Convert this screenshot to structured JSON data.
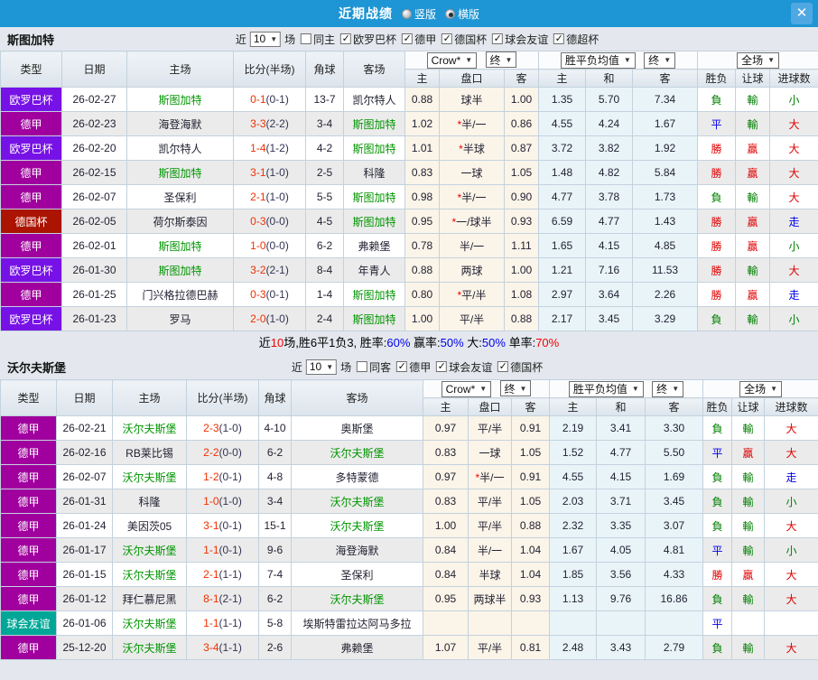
{
  "titlebar": {
    "title": "近期战绩",
    "vertical_label": "竖版",
    "horizontal_label": "横版",
    "selected_layout": "横版",
    "close_glyph": "✕"
  },
  "table_columns": {
    "type": "类型",
    "date": "日期",
    "home": "主场",
    "score": "比分(半场)",
    "corner": "角球",
    "away": "客场",
    "crow": "Crow*",
    "final1": "终",
    "avg": "胜平负均值",
    "final2": "终",
    "scope": "全场",
    "sub_home": "主",
    "sub_handicap": "盘口",
    "sub_away": "客",
    "sub_avg_home": "主",
    "sub_avg_draw": "和",
    "sub_avg_away": "客",
    "sub_result": "胜负",
    "sub_handicap_result": "让球",
    "sub_goals": "进球数",
    "dropdown_arrow": "▼"
  },
  "colors": {
    "accent_blue": "#1e95d4",
    "focus_team_green": "#009500",
    "score_red": "#f23000",
    "type_badges": {
      "欧罗巴杯": "#7712e6",
      "德甲": "#a0009e",
      "德国杯": "#aa1400",
      "球会友谊": "#00a796"
    },
    "result_text": {
      "勝": "#e00000",
      "負": "#008000",
      "平": "#0000ee",
      "贏": "#e00000",
      "輸": "#008000",
      "走": "#0000ee",
      "大": "#e00000",
      "小": "#008000"
    }
  },
  "sections": [
    {
      "team": "斯图加特",
      "filter": {
        "near": "近",
        "games": "10",
        "games_unit": "场",
        "same": {
          "label": "同主",
          "checked": false
        },
        "competitions": [
          {
            "label": "欧罗巴杯",
            "checked": true
          },
          {
            "label": "德甲",
            "checked": true
          },
          {
            "label": "德国杯",
            "checked": true
          },
          {
            "label": "球会友谊",
            "checked": true
          },
          {
            "label": "德超杯",
            "checked": true
          }
        ]
      },
      "rows": [
        {
          "league": "欧罗巴杯",
          "date": "26-02-27",
          "home": "斯图加特",
          "home_is_focus": true,
          "score": "0-1",
          "half": "0-1",
          "corners": "13-7",
          "away": "凯尔特人",
          "away_is_focus": false,
          "crow_home": "0.88",
          "handicap_star": false,
          "handicap": "球半",
          "crow_away": "1.00",
          "avg_home": "1.35",
          "avg_draw": "5.70",
          "avg_away": "7.34",
          "result": "負",
          "handicap_result": "輸",
          "goals": "小"
        },
        {
          "league": "德甲",
          "date": "26-02-23",
          "home": "海登海默",
          "home_is_focus": false,
          "score": "3-3",
          "half": "2-2",
          "corners": "3-4",
          "away": "斯图加特",
          "away_is_focus": true,
          "crow_home": "1.02",
          "handicap_star": true,
          "handicap": "半/一",
          "crow_away": "0.86",
          "avg_home": "4.55",
          "avg_draw": "4.24",
          "avg_away": "1.67",
          "result": "平",
          "handicap_result": "輸",
          "goals": "大"
        },
        {
          "league": "欧罗巴杯",
          "date": "26-02-20",
          "home": "凯尔特人",
          "home_is_focus": false,
          "score": "1-4",
          "half": "1-2",
          "corners": "4-2",
          "away": "斯图加特",
          "away_is_focus": true,
          "crow_home": "1.01",
          "handicap_star": true,
          "handicap": "半球",
          "crow_away": "0.87",
          "avg_home": "3.72",
          "avg_draw": "3.82",
          "avg_away": "1.92",
          "result": "勝",
          "handicap_result": "贏",
          "goals": "大"
        },
        {
          "league": "德甲",
          "date": "26-02-15",
          "home": "斯图加特",
          "home_is_focus": true,
          "score": "3-1",
          "half": "1-0",
          "corners": "2-5",
          "away": "科隆",
          "away_is_focus": false,
          "crow_home": "0.83",
          "handicap_star": false,
          "handicap": "一球",
          "crow_away": "1.05",
          "avg_home": "1.48",
          "avg_draw": "4.82",
          "avg_away": "5.84",
          "result": "勝",
          "handicap_result": "贏",
          "goals": "大"
        },
        {
          "league": "德甲",
          "date": "26-02-07",
          "home": "圣保利",
          "home_is_focus": false,
          "score": "2-1",
          "half": "1-0",
          "corners": "5-5",
          "away": "斯图加特",
          "away_is_focus": true,
          "crow_home": "0.98",
          "handicap_star": true,
          "handicap": "半/一",
          "crow_away": "0.90",
          "avg_home": "4.77",
          "avg_draw": "3.78",
          "avg_away": "1.73",
          "result": "負",
          "handicap_result": "輸",
          "goals": "大"
        },
        {
          "league": "德国杯",
          "date": "26-02-05",
          "home": "荷尔斯泰因",
          "home_is_focus": false,
          "score": "0-3",
          "half": "0-0",
          "corners": "4-5",
          "away": "斯图加特",
          "away_is_focus": true,
          "crow_home": "0.95",
          "handicap_star": true,
          "handicap": "一/球半",
          "crow_away": "0.93",
          "avg_home": "6.59",
          "avg_draw": "4.77",
          "avg_away": "1.43",
          "result": "勝",
          "handicap_result": "贏",
          "goals": "走"
        },
        {
          "league": "德甲",
          "date": "26-02-01",
          "home": "斯图加特",
          "home_is_focus": true,
          "score": "1-0",
          "half": "0-0",
          "corners": "6-2",
          "away": "弗赖堡",
          "away_is_focus": false,
          "crow_home": "0.78",
          "handicap_star": false,
          "handicap": "半/一",
          "crow_away": "1.11",
          "avg_home": "1.65",
          "avg_draw": "4.15",
          "avg_away": "4.85",
          "result": "勝",
          "handicap_result": "贏",
          "goals": "小"
        },
        {
          "league": "欧罗巴杯",
          "date": "26-01-30",
          "home": "斯图加特",
          "home_is_focus": true,
          "score": "3-2",
          "half": "2-1",
          "corners": "8-4",
          "away": "年青人",
          "away_is_focus": false,
          "crow_home": "0.88",
          "handicap_star": false,
          "handicap": "两球",
          "crow_away": "1.00",
          "avg_home": "1.21",
          "avg_draw": "7.16",
          "avg_away": "11.53",
          "result": "勝",
          "handicap_result": "輸",
          "goals": "大"
        },
        {
          "league": "德甲",
          "date": "26-01-25",
          "home": "门兴格拉德巴赫",
          "home_is_focus": false,
          "score": "0-3",
          "half": "0-1",
          "corners": "1-4",
          "away": "斯图加特",
          "away_is_focus": true,
          "crow_home": "0.80",
          "handicap_star": true,
          "handicap": "平/半",
          "crow_away": "1.08",
          "avg_home": "2.97",
          "avg_draw": "3.64",
          "avg_away": "2.26",
          "result": "勝",
          "handicap_result": "贏",
          "goals": "走"
        },
        {
          "league": "欧罗巴杯",
          "date": "26-01-23",
          "home": "罗马",
          "home_is_focus": false,
          "score": "2-0",
          "half": "1-0",
          "corners": "2-4",
          "away": "斯图加特",
          "away_is_focus": true,
          "crow_home": "1.00",
          "handicap_star": false,
          "handicap": "平/半",
          "crow_away": "0.88",
          "avg_home": "2.17",
          "avg_draw": "3.45",
          "avg_away": "3.29",
          "result": "負",
          "handicap_result": "輸",
          "goals": "小"
        }
      ],
      "summary": [
        {
          "t": "近",
          "c": "#000000"
        },
        {
          "t": "10",
          "c": "#f00000"
        },
        {
          "t": "场,胜6平1负3, 胜率:",
          "c": "#000000"
        },
        {
          "t": "60%",
          "c": "#0000ee"
        },
        {
          "t": " 赢率:",
          "c": "#000000"
        },
        {
          "t": "50%",
          "c": "#0000ee"
        },
        {
          "t": " 大:",
          "c": "#000000"
        },
        {
          "t": "50%",
          "c": "#0000ee"
        },
        {
          "t": " 单率:",
          "c": "#000000"
        },
        {
          "t": "70%",
          "c": "#f00000"
        }
      ]
    },
    {
      "team": "沃尔夫斯堡",
      "filter": {
        "near": "近",
        "games": "10",
        "games_unit": "场",
        "same": {
          "label": "同客",
          "checked": false
        },
        "competitions": [
          {
            "label": "德甲",
            "checked": true
          },
          {
            "label": "球会友谊",
            "checked": true
          },
          {
            "label": "德国杯",
            "checked": true
          }
        ]
      },
      "rows": [
        {
          "league": "德甲",
          "date": "26-02-21",
          "home": "沃尔夫斯堡",
          "home_is_focus": true,
          "score": "2-3",
          "half": "1-0",
          "corners": "4-10",
          "away": "奥斯堡",
          "away_is_focus": false,
          "crow_home": "0.97",
          "handicap_star": false,
          "handicap": "平/半",
          "crow_away": "0.91",
          "avg_home": "2.19",
          "avg_draw": "3.41",
          "avg_away": "3.30",
          "result": "負",
          "handicap_result": "輸",
          "goals": "大"
        },
        {
          "league": "德甲",
          "date": "26-02-16",
          "home": "RB莱比锡",
          "home_is_focus": false,
          "score": "2-2",
          "half": "0-0",
          "corners": "6-2",
          "away": "沃尔夫斯堡",
          "away_is_focus": true,
          "crow_home": "0.83",
          "handicap_star": false,
          "handicap": "一球",
          "crow_away": "1.05",
          "avg_home": "1.52",
          "avg_draw": "4.77",
          "avg_away": "5.50",
          "result": "平",
          "handicap_result": "贏",
          "goals": "大"
        },
        {
          "league": "德甲",
          "date": "26-02-07",
          "home": "沃尔夫斯堡",
          "home_is_focus": true,
          "score": "1-2",
          "half": "0-1",
          "corners": "4-8",
          "away": "多特蒙德",
          "away_is_focus": false,
          "crow_home": "0.97",
          "handicap_star": true,
          "handicap": "半/一",
          "crow_away": "0.91",
          "avg_home": "4.55",
          "avg_draw": "4.15",
          "avg_away": "1.69",
          "result": "負",
          "handicap_result": "輸",
          "goals": "走"
        },
        {
          "league": "德甲",
          "date": "26-01-31",
          "home": "科隆",
          "home_is_focus": false,
          "score": "1-0",
          "half": "1-0",
          "corners": "3-4",
          "away": "沃尔夫斯堡",
          "away_is_focus": true,
          "crow_home": "0.83",
          "handicap_star": false,
          "handicap": "平/半",
          "crow_away": "1.05",
          "avg_home": "2.03",
          "avg_draw": "3.71",
          "avg_away": "3.45",
          "result": "負",
          "handicap_result": "輸",
          "goals": "小"
        },
        {
          "league": "德甲",
          "date": "26-01-24",
          "home": "美因茨05",
          "home_is_focus": false,
          "score": "3-1",
          "half": "0-1",
          "corners": "15-1",
          "away": "沃尔夫斯堡",
          "away_is_focus": true,
          "crow_home": "1.00",
          "handicap_star": false,
          "handicap": "平/半",
          "crow_away": "0.88",
          "avg_home": "2.32",
          "avg_draw": "3.35",
          "avg_away": "3.07",
          "result": "負",
          "handicap_result": "輸",
          "goals": "大"
        },
        {
          "league": "德甲",
          "date": "26-01-17",
          "home": "沃尔夫斯堡",
          "home_is_focus": true,
          "score": "1-1",
          "half": "0-1",
          "corners": "9-6",
          "away": "海登海默",
          "away_is_focus": false,
          "crow_home": "0.84",
          "handicap_star": false,
          "handicap": "半/一",
          "crow_away": "1.04",
          "avg_home": "1.67",
          "avg_draw": "4.05",
          "avg_away": "4.81",
          "result": "平",
          "handicap_result": "輸",
          "goals": "小"
        },
        {
          "league": "德甲",
          "date": "26-01-15",
          "home": "沃尔夫斯堡",
          "home_is_focus": true,
          "score": "2-1",
          "half": "1-1",
          "corners": "7-4",
          "away": "圣保利",
          "away_is_focus": false,
          "crow_home": "0.84",
          "handicap_star": false,
          "handicap": "半球",
          "crow_away": "1.04",
          "avg_home": "1.85",
          "avg_draw": "3.56",
          "avg_away": "4.33",
          "result": "勝",
          "handicap_result": "贏",
          "goals": "大"
        },
        {
          "league": "德甲",
          "date": "26-01-12",
          "home": "拜仁慕尼黑",
          "home_is_focus": false,
          "score": "8-1",
          "half": "2-1",
          "corners": "6-2",
          "away": "沃尔夫斯堡",
          "away_is_focus": true,
          "crow_home": "0.95",
          "handicap_star": false,
          "handicap": "两球半",
          "crow_away": "0.93",
          "avg_home": "1.13",
          "avg_draw": "9.76",
          "avg_away": "16.86",
          "result": "負",
          "handicap_result": "輸",
          "goals": "大"
        },
        {
          "league": "球会友谊",
          "date": "26-01-06",
          "home": "沃尔夫斯堡",
          "home_is_focus": true,
          "score": "1-1",
          "half": "1-1",
          "corners": "5-8",
          "away": "埃斯特雷拉达阿马多拉",
          "away_is_focus": false,
          "crow_home": "",
          "handicap_star": false,
          "handicap": "",
          "crow_away": "",
          "avg_home": "",
          "avg_draw": "",
          "avg_away": "",
          "result": "平",
          "handicap_result": "",
          "goals": ""
        },
        {
          "league": "德甲",
          "date": "25-12-20",
          "home": "沃尔夫斯堡",
          "home_is_focus": true,
          "score": "3-4",
          "half": "1-1",
          "corners": "2-6",
          "away": "弗赖堡",
          "away_is_focus": false,
          "crow_home": "1.07",
          "handicap_star": false,
          "handicap": "平/半",
          "crow_away": "0.81",
          "avg_home": "2.48",
          "avg_draw": "3.43",
          "avg_away": "2.79",
          "result": "負",
          "handicap_result": "輸",
          "goals": "大"
        }
      ],
      "summary": []
    }
  ]
}
